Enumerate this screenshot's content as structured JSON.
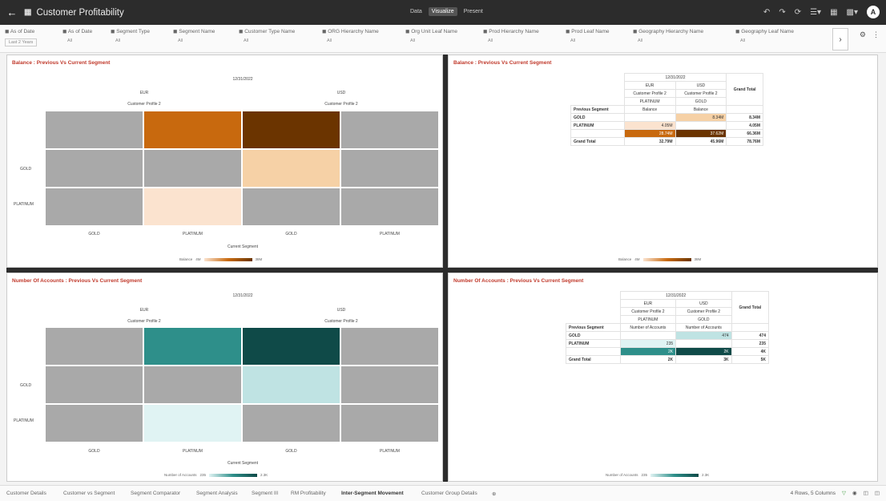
{
  "app": {
    "title": "Customer Profitability",
    "modes": [
      "Data",
      "Visualize",
      "Present"
    ],
    "active_mode": "Visualize"
  },
  "filters": [
    {
      "label": "As of Date",
      "value": "Last 2 Years"
    },
    {
      "label": "As of Date",
      "value": "All"
    },
    {
      "label": "Segment Type",
      "value": "All"
    },
    {
      "label": "Segment Name",
      "value": "All"
    },
    {
      "label": "Customer Type Name",
      "value": "All"
    },
    {
      "label": "ORG Hierarchy Name",
      "value": "All"
    },
    {
      "label": "Org Unit Leaf Name",
      "value": "All"
    },
    {
      "label": "Prod Hierarchy Name",
      "value": "All"
    },
    {
      "label": "Prod Leaf Name",
      "value": "All"
    },
    {
      "label": "Geography Hierarchy Name",
      "value": "All"
    },
    {
      "label": "Geography Leaf Name",
      "value": "All"
    }
  ],
  "panels": {
    "bal_heatmap": {
      "title": "Balance : Previous Vs Current Segment",
      "date": "12/31/2022",
      "currencies": [
        "EUR",
        "USD"
      ],
      "profile": "Customer Profile 2",
      "rows": [
        "GOLD",
        "PLATINUM"
      ],
      "cols": [
        "GOLD",
        "PLATINUM",
        "GOLD",
        "PLATINUM"
      ],
      "x_title": "Current Segment",
      "legend": {
        "label": "Balance",
        "min": "4M",
        "max": "38M"
      }
    },
    "bal_table": {
      "title": "Balance : Previous Vs Current Segment",
      "date": "12/31/2022",
      "col_hdrs": [
        [
          "EUR",
          "USD"
        ],
        [
          "Customer Profile 2",
          "Customer Profile 2"
        ],
        [
          "PLATINUM",
          "GOLD"
        ],
        [
          "Balance",
          "Balance"
        ]
      ],
      "row_hdr": "Previous Segment",
      "grand": "Grand Total",
      "rows": [
        {
          "label": "GOLD",
          "v1": "",
          "v2": "8.34M",
          "total": "8.34M"
        },
        {
          "label": "PLATINUM",
          "v1": "4.05M",
          "v2": "",
          "total": "4.05M"
        },
        {
          "label": "",
          "v1": "28.74M",
          "v2": "37.62M",
          "total": "66.36M"
        }
      ],
      "grand_row": {
        "label": "Grand Total",
        "v1": "32.79M",
        "v2": "45.96M",
        "total": "78.76M"
      },
      "legend": {
        "label": "Balance",
        "min": "4M",
        "max": "38M"
      }
    },
    "acc_heatmap": {
      "title": "Number Of Accounts : Previous Vs Current Segment",
      "date": "12/31/2022",
      "currencies": [
        "EUR",
        "USD"
      ],
      "profile": "Customer Profile 2",
      "rows": [
        "GOLD",
        "PLATINUM"
      ],
      "cols": [
        "GOLD",
        "PLATINUM",
        "GOLD",
        "PLATINUM"
      ],
      "x_title": "Current Segment",
      "legend": {
        "label": "Number of Accounts",
        "min": "235",
        "max": "2.3K"
      }
    },
    "acc_table": {
      "title": "Number Of Accounts : Previous Vs Current Segment",
      "date": "12/31/2022",
      "col_hdrs": [
        [
          "EUR",
          "USD"
        ],
        [
          "Customer Profile 2",
          "Customer Profile 2"
        ],
        [
          "PLATINUM",
          "GOLD"
        ],
        [
          "Number of Accounts",
          "Number of Accounts"
        ]
      ],
      "row_hdr": "Previous Segment",
      "grand": "Grand Total",
      "rows": [
        {
          "label": "GOLD",
          "v1": "",
          "v2": "474",
          "total": "474"
        },
        {
          "label": "PLATINUM",
          "v1": "235",
          "v2": "",
          "total": "235"
        },
        {
          "label": "",
          "v1": "2K",
          "v2": "2K",
          "total": "4K"
        }
      ],
      "grand_row": {
        "label": "Grand Total",
        "v1": "2K",
        "v2": "3K",
        "total": "5K"
      },
      "legend": {
        "label": "Number of Accounts",
        "min": "235",
        "max": "2.3K"
      }
    }
  },
  "footer": {
    "tabs": [
      "Customer Details",
      "Customer vs Segment",
      "Segment Comparator",
      "Segment Analysis",
      "Segment III",
      "RM Profitability",
      "Inter-Segment Movement",
      "Customer Group Details"
    ],
    "active_tab": "Inter-Segment Movement",
    "status": "4 Rows, 5 Columns"
  },
  "colors": {
    "balance_dark": "#6b3400",
    "balance_mid": "#c8690e",
    "balance_light": "#f6d1a6",
    "balance_pale": "#fbe3cf",
    "accounts_dark": "#0f4a48",
    "accounts_mid": "#2e8f8a",
    "accounts_light": "#bfe3e3",
    "accounts_pale": "#e0f3f3",
    "null_cell": "#a9a9a9"
  }
}
